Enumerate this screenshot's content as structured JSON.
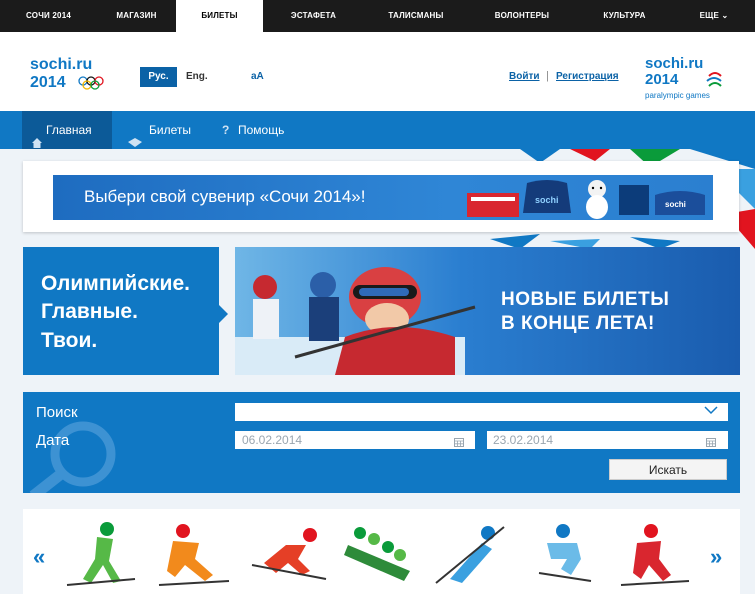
{
  "top_nav": [
    "СОЧИ 2014",
    "МАГАЗИН",
    "БИЛЕТЫ",
    "ЭСТАФЕТА",
    "ТАЛИСМАНЫ",
    "ВОЛОНТЕРЫ",
    "КУЛЬТУРА",
    "ЕЩЕ ⌄"
  ],
  "header": {
    "logo_top": "sochi.ru",
    "logo_bottom": "2014",
    "lang_ru": "Рус.",
    "lang_en": "Eng.",
    "font_size": "aA",
    "login": "Войти",
    "separator": "|",
    "register": "Регистрация",
    "para_logo_top": "sochi.ru",
    "para_logo_bottom": "2014",
    "para_logo_sub": "paralympic games"
  },
  "blue_nav": {
    "home": "Главная",
    "tickets": "Билеты",
    "help": "Помощь"
  },
  "banner": {
    "text": "Выбери свой сувенир «Сочи 2014»!"
  },
  "hero": {
    "line1": "Олимпийские.",
    "line2": "Главные.",
    "line3": "Твои.",
    "title1": "НОВЫЕ БИЛЕТЫ",
    "title2": "В КОНЦЕ ЛЕТА!"
  },
  "search": {
    "label_search": "Поиск",
    "label_date": "Дата",
    "date_from": "06.02.2014",
    "date_to": "23.02.2014",
    "button": "Искать"
  },
  "sports": {
    "prev": "«",
    "next": "»"
  },
  "colors": {
    "accent": "#1078c4",
    "nav_dark": "#1b1b1b"
  }
}
